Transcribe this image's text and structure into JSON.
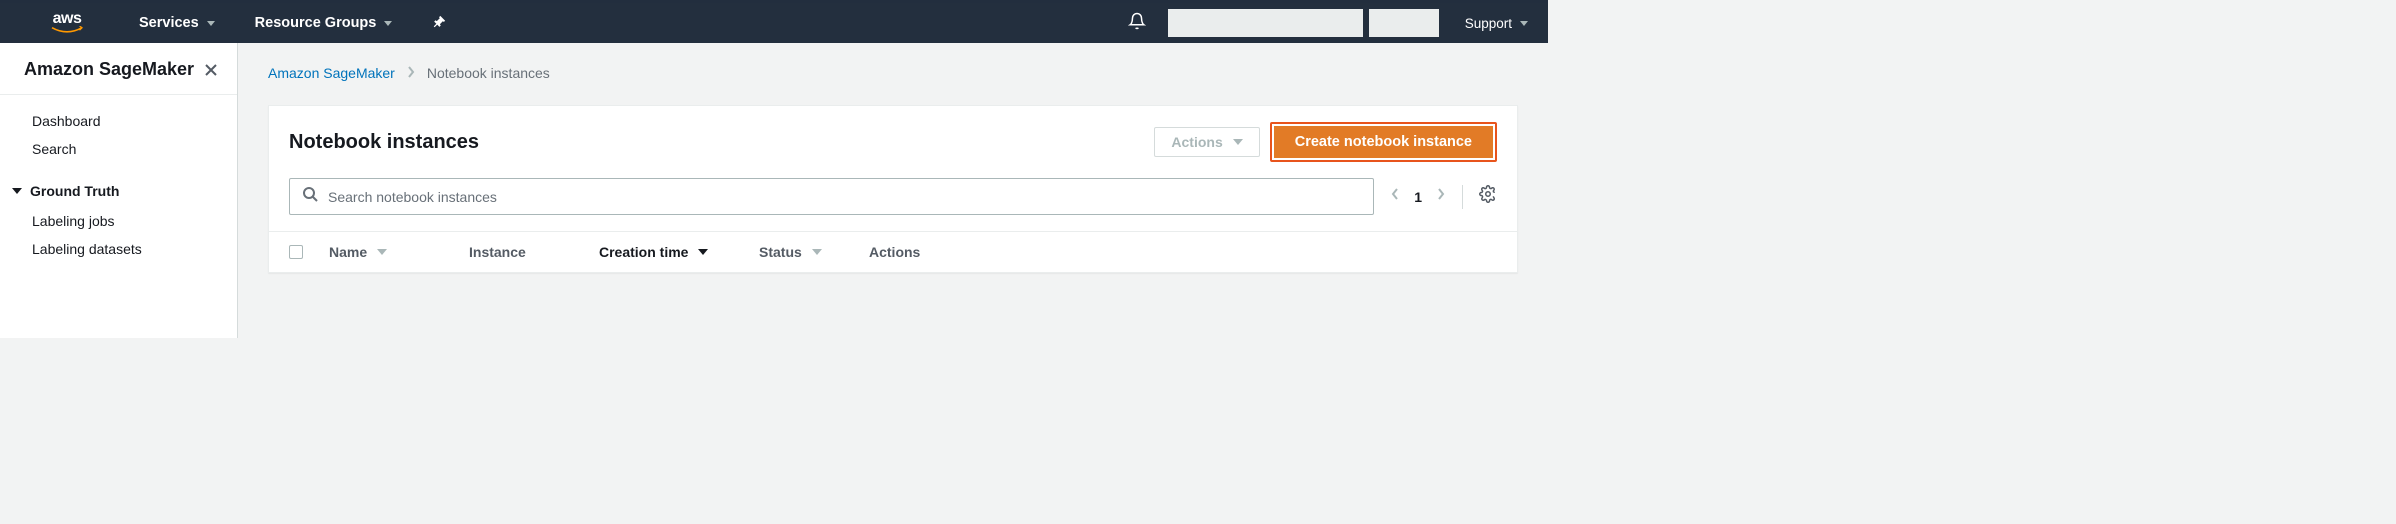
{
  "nav": {
    "services": "Services",
    "resource_groups": "Resource Groups",
    "support": "Support"
  },
  "sidebar": {
    "title": "Amazon SageMaker",
    "items": [
      "Dashboard",
      "Search"
    ],
    "group_label": "Ground Truth",
    "group_items": [
      "Labeling jobs",
      "Labeling datasets"
    ]
  },
  "breadcrumb": {
    "root": "Amazon SageMaker",
    "current": "Notebook instances"
  },
  "panel": {
    "title": "Notebook instances",
    "actions_label": "Actions",
    "create_label": "Create notebook instance",
    "search_placeholder": "Search notebook instances",
    "page": "1"
  },
  "columns": {
    "name": "Name",
    "instance": "Instance",
    "creation": "Creation time",
    "status": "Status",
    "actions": "Actions"
  }
}
